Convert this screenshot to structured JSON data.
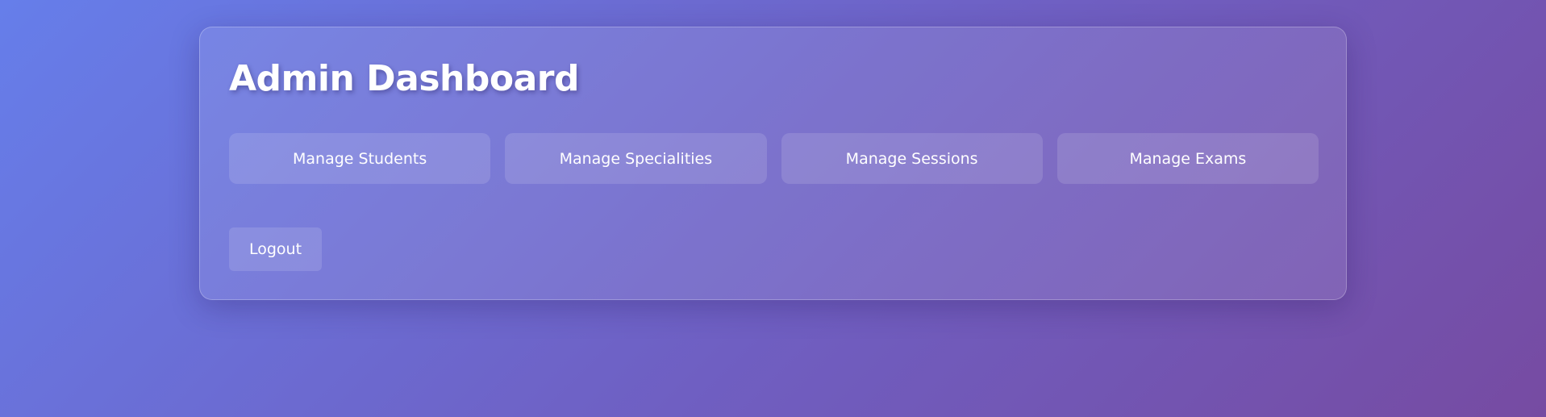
{
  "dashboard": {
    "title": "Admin Dashboard",
    "nav_buttons": [
      {
        "label": "Manage Students"
      },
      {
        "label": "Manage Specialities"
      },
      {
        "label": "Manage Sessions"
      },
      {
        "label": "Manage Exams"
      }
    ],
    "logout_label": "Logout"
  },
  "colors": {
    "background_gradient_start": "#667eea",
    "background_gradient_end": "#764ba2",
    "text": "#ffffff"
  }
}
